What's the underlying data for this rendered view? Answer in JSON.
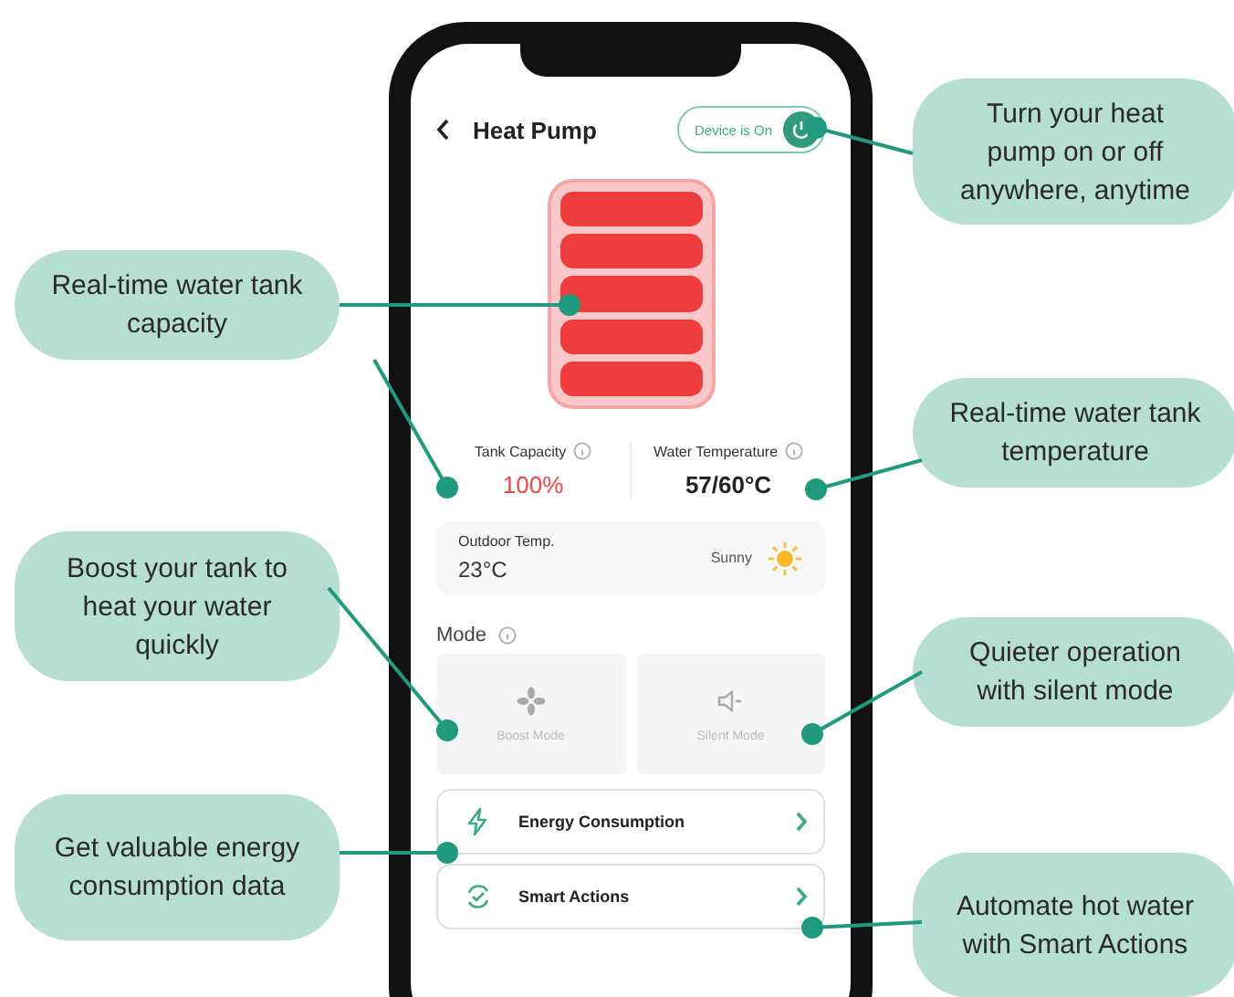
{
  "screen": {
    "title": "Heat Pump",
    "device": {
      "label": "Device is On",
      "on": true
    },
    "tank": {
      "level": 1
    },
    "stats": [
      {
        "label": "Tank Capacity",
        "value": "100%",
        "kind": "alert"
      },
      {
        "label": "Water Temperature",
        "value": "57/60°C",
        "kind": "normal"
      }
    ],
    "outdoor": {
      "label": "Outdoor Temp.",
      "value": "23°C",
      "weather": "Sunny"
    },
    "mode": {
      "label": "Mode",
      "options": [
        {
          "label": "Boost Mode",
          "kind": "boost",
          "selected": false
        },
        {
          "label": "Silent Mode",
          "kind": "silent",
          "selected": false
        }
      ]
    },
    "menu": [
      {
        "label": "Energy Consumption",
        "kind": "energy"
      },
      {
        "label": "Smart Actions",
        "kind": "smart"
      }
    ]
  },
  "callouts": [
    {
      "text": "Turn your heat pump on or off anywhere, anytime"
    },
    {
      "text": "Real-time water tank capacity"
    },
    {
      "text": "Real-time water tank temperature"
    },
    {
      "text": "Boost your tank to heat your water quickly"
    },
    {
      "text": "Quieter operation with silent mode"
    },
    {
      "text": "Get valuable energy consumption data"
    },
    {
      "text": "Automate hot water with Smart Actions"
    }
  ]
}
